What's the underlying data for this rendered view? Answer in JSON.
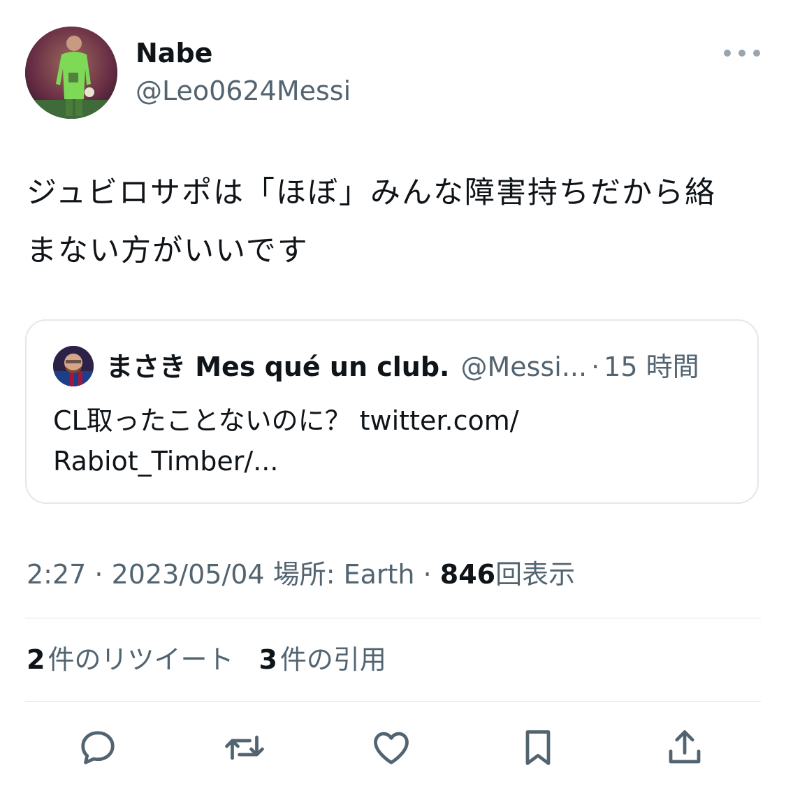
{
  "author": {
    "display_name": "Nabe",
    "handle": "@Leo0624Messi",
    "avatar_icon": "goalkeeper-photo"
  },
  "more_icon": "more-horizontal-icon",
  "tweet": {
    "text_lines": [
      "ジュビロサポは「ほぼ」みんな障害持ちだから絡",
      "まない方がいいです"
    ]
  },
  "quoted": {
    "display_name": "まさき Mes qué un club.",
    "handle": "@Messi...",
    "separator": "·",
    "time": "15 時間",
    "text_lines": [
      "CL取ったことないのに？ twitter.com/",
      "Rabiot_Timber/..."
    ]
  },
  "meta": {
    "time": "2:27",
    "sep1": " · ",
    "date": "2023/05/04",
    "location": " 場所: Earth",
    "sep2": " · ",
    "views_count": "846",
    "views_label": "回表示"
  },
  "counts": {
    "retweets_count": "2",
    "retweets_label": "件のリツイート",
    "quotes_count": "3",
    "quotes_label": "件の引用"
  },
  "actions": [
    "reply-icon",
    "retweet-icon",
    "like-icon",
    "bookmark-icon",
    "share-icon"
  ],
  "colors": {
    "text": "#0f1419",
    "secondary": "#536471",
    "border": "#e1e8ed"
  }
}
